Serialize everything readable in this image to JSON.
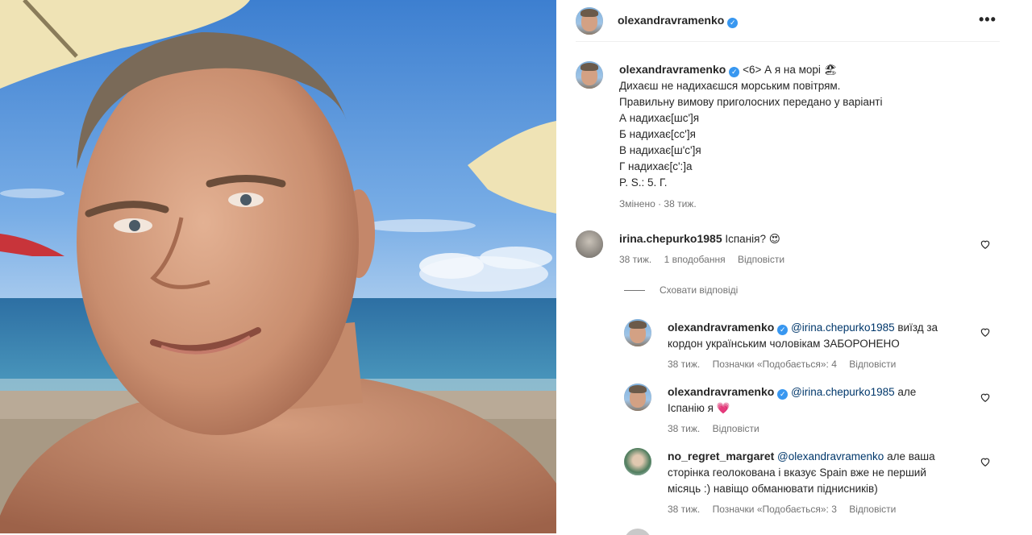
{
  "post": {
    "author": "olexandravramenko",
    "more_icon": "more-horizontal-icon",
    "caption": {
      "username": "olexandravramenko",
      "lines": [
        "<6> А я на морі 🏖",
        "Дихаєш не надихаєшся морським повітрям.",
        "Правильну вимову приголосних передано у варіанті",
        "А надихає[шс']я",
        "Б надихає[сс']я",
        "В надихає[ш'с']я",
        "Г надихає[с':]а",
        "P. S.: 5. Г."
      ],
      "meta": "Змінено · 38 тиж."
    }
  },
  "comments": [
    {
      "username": "irina.chepurko1985",
      "text": " Іспанія? 😍",
      "time": "38 тиж.",
      "likes": "1 вподобання",
      "reply": "Відповісти"
    }
  ],
  "hide_replies": "Сховати відповіді",
  "replies": [
    {
      "username": "olexandravramenko",
      "mention": "@irina.chepurko1985",
      "text_line1": " виїзд за",
      "text_line2": "кордон українським чоловікам ЗАБОРОНЕНО",
      "time": "38 тиж.",
      "likes": "Позначки «Подобається»: 4",
      "reply": "Відповісти"
    },
    {
      "username": "olexandravramenko",
      "mention": "@irina.chepurko1985",
      "text_line1": " але",
      "text_line2": "Іспанію я ",
      "emoji": "💗",
      "time": "38 тиж.",
      "reply": "Відповісти"
    },
    {
      "username": "no_regret_margaret",
      "mention": "@olexandravramenko",
      "text_line1": " але ваша",
      "text_line2": "сторінка геолокована і вказує Spain вже не перший",
      "text_line3": "місяць :) навіщо обманювати піднисників)",
      "time": "38 тиж.",
      "likes": "Позначки «Подобається»: 3",
      "reply": "Відповісти"
    }
  ],
  "colors": {
    "text": "#262626",
    "muted": "#737373",
    "mention": "#00376b",
    "verified": "#3897f0"
  }
}
